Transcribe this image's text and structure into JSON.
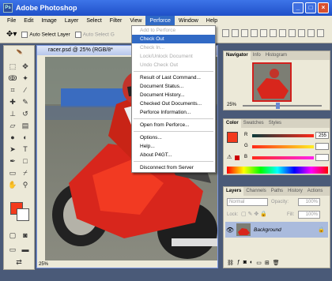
{
  "window": {
    "title": "Adobe Photoshop"
  },
  "menu": {
    "items": [
      "File",
      "Edit",
      "Image",
      "Layer",
      "Select",
      "Filter",
      "View",
      "Perforce",
      "Window",
      "Help"
    ],
    "active": "Perforce"
  },
  "options": {
    "auto_select_layer": "Auto Select Layer",
    "auto_select_group": "Auto Select G"
  },
  "document": {
    "title": "racer.psd @ 25% (RGB/8*",
    "zoom": "25%"
  },
  "perforce_menu": [
    {
      "label": "Add to Perforce",
      "state": "disabled"
    },
    {
      "label": "Check Out",
      "state": "selected"
    },
    {
      "label": "Check In...",
      "state": "disabled"
    },
    {
      "label": "Lock/Unlock Document",
      "state": "disabled"
    },
    {
      "label": "Undo Check Out",
      "state": "disabled"
    },
    {
      "label": "Result of Last Command...",
      "state": "normal",
      "sep_before": true
    },
    {
      "label": "Document Status...",
      "state": "normal"
    },
    {
      "label": "Document History...",
      "state": "normal"
    },
    {
      "label": "Checked Out Documents...",
      "state": "normal"
    },
    {
      "label": "Perforce Information...",
      "state": "normal"
    },
    {
      "label": "Open from Perforce...",
      "state": "normal",
      "sep_before": true
    },
    {
      "label": "Options...",
      "state": "normal",
      "sep_before": true
    },
    {
      "label": "Help...",
      "state": "normal"
    },
    {
      "label": "About P4GT...",
      "state": "normal"
    },
    {
      "label": "Disconnect from Server",
      "state": "normal",
      "sep_before": true
    }
  ],
  "navigator": {
    "tabs": [
      "Navigator",
      "Info",
      "Histogram"
    ],
    "zoom": "25%"
  },
  "color": {
    "tabs": [
      "Color",
      "Swatches",
      "Styles"
    ],
    "channels": [
      {
        "name": "R",
        "value": "255",
        "color": "#ff2a1a"
      },
      {
        "name": "G",
        "value": "",
        "color": "#00aa44"
      },
      {
        "name": "B",
        "value": "",
        "color": "#2244ee"
      }
    ],
    "foreground": "#f33a1c"
  },
  "layers": {
    "tabs": [
      "Layers",
      "Channels",
      "Paths",
      "History",
      "Actions"
    ],
    "mode": "Normal",
    "opacity_label": "Opacity:",
    "opacity": "100%",
    "lock_label": "Lock:",
    "fill_label": "Fill:",
    "fill": "100%",
    "layer_name": "Background"
  }
}
